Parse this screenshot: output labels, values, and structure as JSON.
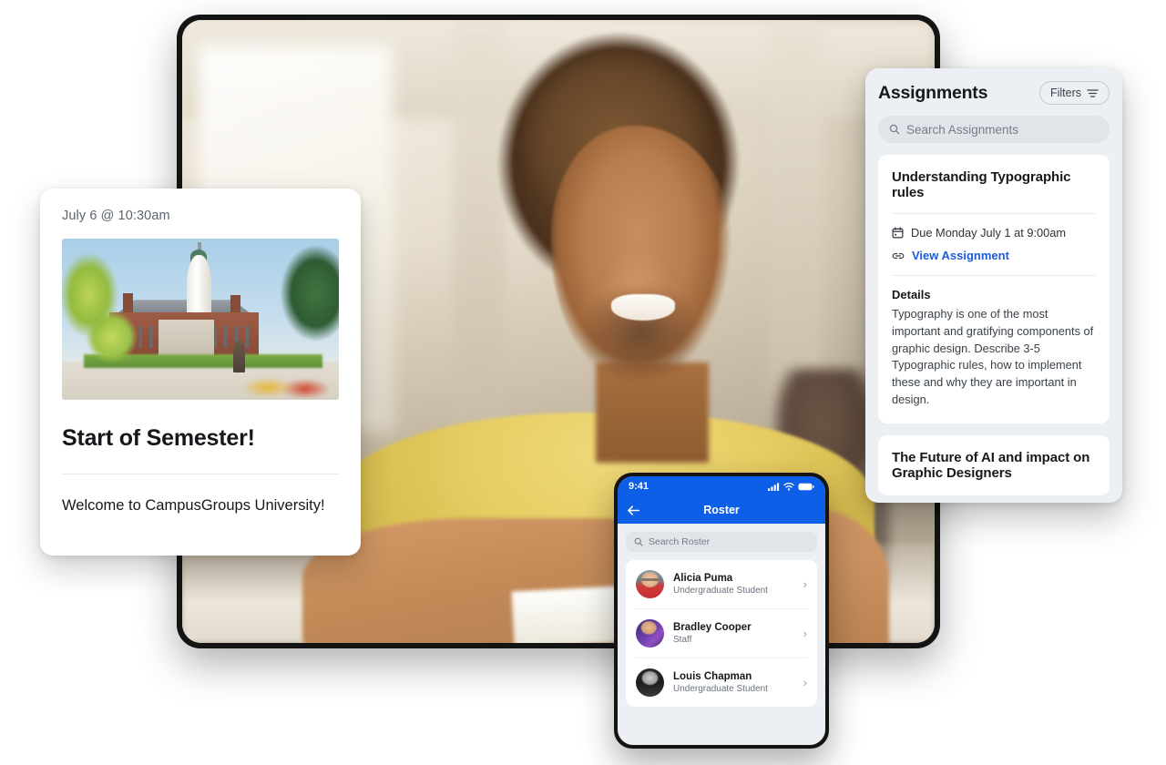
{
  "announcement": {
    "date": "July 6 @ 10:30am",
    "title": "Start of Semester!",
    "body": "Welcome to CampusGroups University!",
    "photo_alt": "campus-building-photo"
  },
  "assignments_panel": {
    "title": "Assignments",
    "filters_label": "Filters",
    "search_placeholder": "Search Assignments",
    "cards": [
      {
        "title": "Understanding Typographic rules",
        "due": "Due Monday July 1 at 9:00am",
        "link_label": "View Assignment",
        "details_heading": "Details",
        "details_text": "Typography is one of the most important and gratifying components of graphic design. Describe 3-5 Typographic rules, how to implement these and why they are important in design."
      },
      {
        "title": "The Future of AI and impact on Graphic Designers"
      }
    ]
  },
  "phone": {
    "status_time": "9:41",
    "nav_title": "Roster",
    "search_placeholder": "Search Roster",
    "roster": [
      {
        "name": "Alicia Puma",
        "role": "Undergraduate Student"
      },
      {
        "name": "Bradley Cooper",
        "role": "Staff"
      },
      {
        "name": "Louis Chapman",
        "role": "Undergraduate Student"
      }
    ]
  },
  "colors": {
    "brand_blue": "#0d5fe8",
    "link_blue": "#1d5bd8",
    "panel_bg": "#eceff3",
    "card_bg": "#ffffff",
    "text_dark": "#16181c"
  }
}
